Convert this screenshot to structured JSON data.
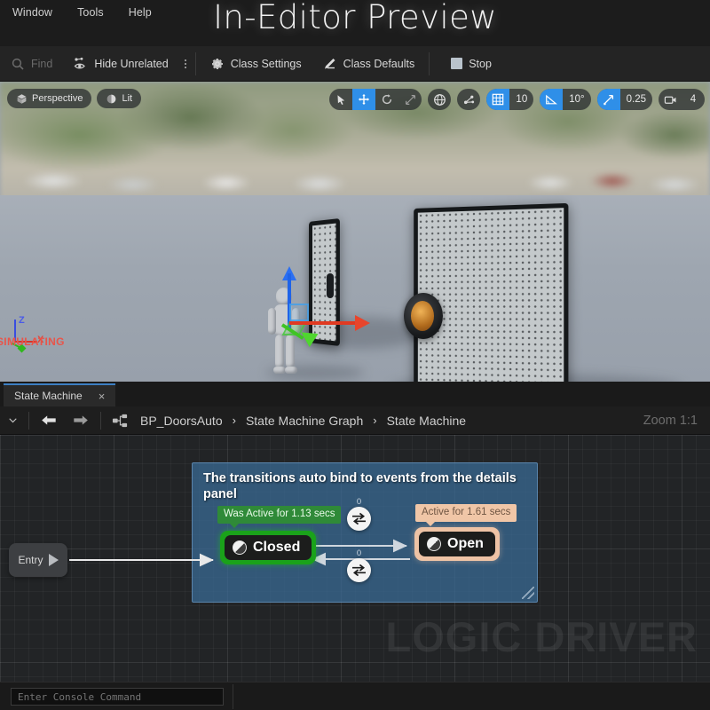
{
  "menubar": {
    "items": [
      {
        "label": "Window"
      },
      {
        "label": "Tools"
      },
      {
        "label": "Help"
      }
    ],
    "preview_title": "In-Editor Preview"
  },
  "bp_toolbar": {
    "find_label": "Find",
    "hide_unrelated_label": "Hide Unrelated",
    "class_settings_label": "Class Settings",
    "class_defaults_label": "Class Defaults",
    "stop_label": "Stop"
  },
  "viewport": {
    "perspective_label": "Perspective",
    "lit_label": "Lit",
    "grid_snap_value": "10",
    "rotation_snap_value": "10°",
    "scale_snap_value": "0.25",
    "camera_speed_value": "4",
    "status_text": "SIMULATING",
    "axis_z": "Z",
    "axis_x": "X"
  },
  "tabs": {
    "state_machine_tab": "State Machine",
    "close_glyph": "×"
  },
  "breadcrumb": {
    "items": [
      {
        "label": "BP_DoorsAuto"
      },
      {
        "label": "State Machine Graph"
      },
      {
        "label": "State Machine"
      }
    ],
    "separator": "›",
    "zoom_label": "Zoom 1:1"
  },
  "graph": {
    "watermark": "LOGIC DRIVER",
    "comment_text": "The transitions auto bind to events from the details panel",
    "entry_label": "Entry",
    "nodes": [
      {
        "id": "closed",
        "label": "Closed",
        "tooltip": "Was Active for 1.13 secs",
        "accent": "#1aa21a",
        "tooltip_bg": "#2f8a38"
      },
      {
        "id": "open",
        "label": "Open",
        "tooltip": "Active for 1.61 secs",
        "accent": "#eec3a5",
        "tooltip_bg": "#f0c6a7"
      }
    ],
    "transitions": [
      {
        "id": "top",
        "count": "0"
      },
      {
        "id": "bottom",
        "count": "0"
      }
    ]
  },
  "footer": {
    "console_placeholder": "Enter Console Command"
  }
}
